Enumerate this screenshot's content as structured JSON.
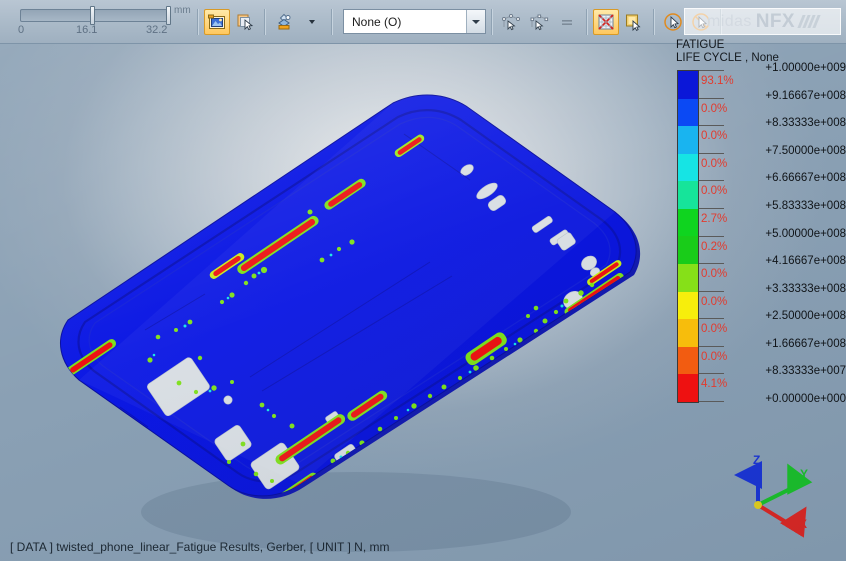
{
  "window": {
    "app_name": "midas NFX"
  },
  "toolbar": {
    "slider": {
      "name": "clipping-slider",
      "unit": "mm",
      "min_label": "0",
      "mid_label": "16.1",
      "max_label": "32.2",
      "min_value": 0,
      "mid_value": 16.1,
      "max_value": 32.2
    },
    "buttons": [
      {
        "name": "capture-image-button",
        "icon": "camera-image-icon",
        "active": true
      },
      {
        "name": "copy-to-clipboard-button",
        "icon": "copy-cursor-icon",
        "active": false
      },
      {
        "name": "view-style-button",
        "icon": "shading-palette-icon",
        "active": false
      },
      {
        "name": "view-style-dropdown-button",
        "icon": "chevron-down-icon",
        "active": false
      },
      {
        "name": "probe-node-button",
        "icon": "node-pick-icon",
        "active": false
      },
      {
        "name": "probe-element-button",
        "icon": "element-pick-icon",
        "active": false
      },
      {
        "name": "probe-value-button",
        "icon": "equal-probe-icon",
        "active": false
      },
      {
        "name": "show-mesh-button",
        "icon": "mesh-cross-icon",
        "active": true
      },
      {
        "name": "select-face-button",
        "icon": "face-select-icon",
        "active": false
      },
      {
        "name": "select-cursor-on-button",
        "icon": "cursor-enabled-icon",
        "active": false
      },
      {
        "name": "select-cursor-off-button",
        "icon": "cursor-disabled-icon",
        "active": false
      }
    ],
    "combo": {
      "name": "result-step-combo",
      "value": "None (O)",
      "placeholder": "None (O)"
    }
  },
  "logo": {
    "prefix": "midas",
    "main": "NFX"
  },
  "legend": {
    "title": "FATIGUE",
    "subtitle": "LIFE CYCLE , None",
    "values": [
      "+1.00000e+009",
      "+9.16667e+008",
      "+8.33333e+008",
      "+7.50000e+008",
      "+6.66667e+008",
      "+5.83333e+008",
      "+5.00000e+008",
      "+4.16667e+008",
      "+3.33333e+008",
      "+2.50000e+008",
      "+1.66667e+008",
      "+8.33333e+007",
      "+0.00000e+000"
    ],
    "percents": [
      "93.1%",
      "0.0%",
      "0.0%",
      "0.0%",
      "0.0%",
      "2.7%",
      "0.2%",
      "0.0%",
      "0.0%",
      "0.0%",
      "0.0%",
      "4.1%"
    ],
    "colors": [
      "#0b17d8",
      "#0b49f4",
      "#19b4f0",
      "#16e4e4",
      "#16e49a",
      "#0fd41f",
      "#19cc19",
      "#86e018",
      "#f7ee0c",
      "#f7bd0c",
      "#f25c11",
      "#ee1111"
    ],
    "percent_color": "#e23b2e"
  },
  "triad": {
    "x_label": "X",
    "y_label": "Y",
    "z_label": "Z",
    "x_color": "#e0241f",
    "y_color": "#19c227",
    "z_color": "#1933d6"
  },
  "status": {
    "text": "[ DATA ]  twisted_phone_linear_Fatigue Results,  Gerber,   [ UNIT ]   N,  mm"
  },
  "chart_data": {
    "type": "bar",
    "title": "FATIGUE LIFE CYCLE , None",
    "xlabel": "",
    "ylabel": "Life Cycle",
    "categories": [
      "+9.16667e+008 – +1.00000e+009",
      "+8.33333e+008 – +9.16667e+008",
      "+7.50000e+008 – +8.33333e+008",
      "+6.66667e+008 – +7.50000e+008",
      "+5.83333e+008 – +6.66667e+008",
      "+5.00000e+008 – +5.83333e+008",
      "+4.16667e+008 – +5.00000e+008",
      "+3.33333e+008 – +4.16667e+008",
      "+2.50000e+008 – +3.33333e+008",
      "+1.66667e+008 – +2.50000e+008",
      "+8.33333e+007 – +1.66667e+008",
      "+0.00000e+000 – +8.33333e+007"
    ],
    "values": [
      93.1,
      0.0,
      0.0,
      0.0,
      0.0,
      2.7,
      0.2,
      0.0,
      0.0,
      0.0,
      0.0,
      4.1
    ],
    "ylim": [
      0,
      100
    ],
    "grid": false,
    "legend_position": "right"
  }
}
